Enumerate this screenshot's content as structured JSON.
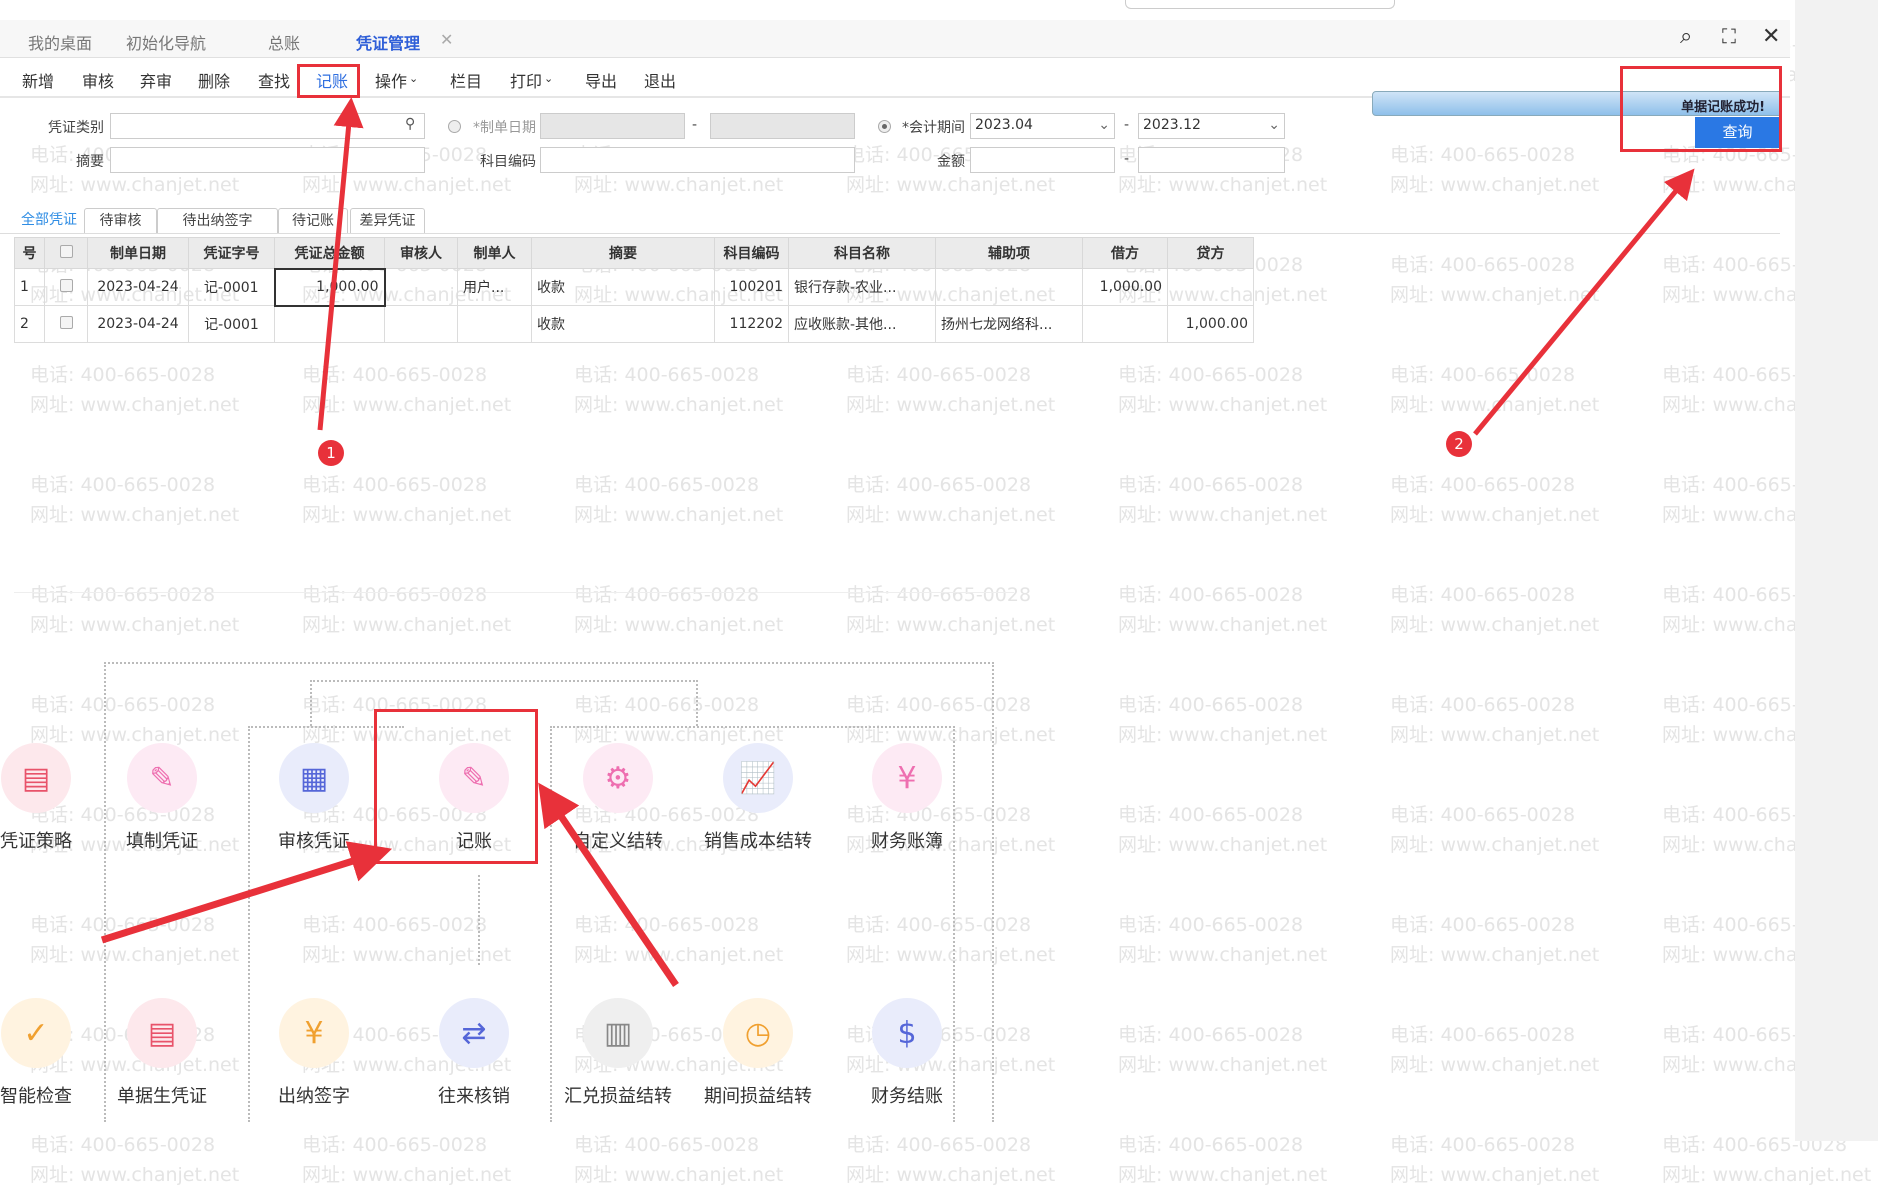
{
  "watermark": {
    "phone": "电话: 400-665-0028",
    "site": "网址: www.chanjet.net"
  },
  "tabs": [
    {
      "label": "我的桌面"
    },
    {
      "label": "初始化导航"
    },
    {
      "label": "总账"
    },
    {
      "label": "凭证管理",
      "active": true
    }
  ],
  "tab_close": "✕",
  "window_icons": {
    "search": "search-icon",
    "fullscreen": "expand-icon",
    "close": "close-icon"
  },
  "toolbar": [
    "新增",
    "审核",
    "弃审",
    "删除",
    "查找",
    "记账",
    "操作",
    "栏目",
    "打印",
    "导出",
    "退出"
  ],
  "filters": {
    "voucher_type_label": "凭证类别",
    "voucher_type_value": "",
    "summary_label": "摘要",
    "summary_value": "",
    "date_label": "*制单日期",
    "date_from": "",
    "date_to": "",
    "account_code_label": "科目编码",
    "account_code_value": "",
    "period_label": "*会计期间",
    "period_from": "2023.04",
    "period_to": "2023.12",
    "amount_label": "金额",
    "amount_from": "",
    "amount_to": "",
    "dash": "-"
  },
  "notice": {
    "message": "单据记账成功!",
    "query_button": "查询"
  },
  "filter_tabs": [
    "全部凭证",
    "待审核",
    "待出纳签字",
    "待记账",
    "差异凭证"
  ],
  "table": {
    "headers": [
      "号",
      "",
      "制单日期",
      "凭证字号",
      "凭证总金额",
      "审核人",
      "制单人",
      "摘要",
      "科目编码",
      "科目名称",
      "辅助项",
      "借方",
      "贷方"
    ],
    "rows": [
      [
        "1",
        "",
        "2023-04-24",
        "记-0001",
        "1,000.00",
        "",
        "用户...",
        "收款",
        "100201",
        "银行存款-农业...",
        "",
        "1,000.00",
        ""
      ],
      [
        "2",
        "",
        "2023-04-24",
        "记-0001",
        "",
        "",
        "",
        "收款",
        "112202",
        "应收账款-其他...",
        "扬州七龙网络科...",
        "",
        "1,000.00"
      ]
    ]
  },
  "annotations": [
    "1",
    "2"
  ],
  "flow": {
    "row1": [
      {
        "label": "凭证策略",
        "color": "#e8536a",
        "bg": "#fde8ec",
        "icon": "▤"
      },
      {
        "label": "填制凭证",
        "color": "#ee6fb0",
        "bg": "#fdeaf4",
        "icon": "✎"
      },
      {
        "label": "审核凭证",
        "color": "#5566d8",
        "bg": "#e9ecfb",
        "icon": "▦"
      },
      {
        "label": "记账",
        "color": "#ee6fb0",
        "bg": "#fdeaf4",
        "icon": "✎"
      },
      {
        "label": "自定义结转",
        "color": "#ee6fb0",
        "bg": "#fdeaf4",
        "icon": "⚙"
      },
      {
        "label": "销售成本结转",
        "color": "#5566d8",
        "bg": "#e9ecfb",
        "icon": "📈"
      },
      {
        "label": "财务账簿",
        "color": "#ee6fb0",
        "bg": "#fdeaf4",
        "icon": "¥"
      }
    ],
    "row2": [
      {
        "label": "智能检查",
        "color": "#f0a030",
        "bg": "#fff3e0",
        "icon": "✓"
      },
      {
        "label": "单据生凭证",
        "color": "#e8536a",
        "bg": "#fde8ec",
        "icon": "▤"
      },
      {
        "label": "出纳签字",
        "color": "#f0a030",
        "bg": "#fff3e0",
        "icon": "¥"
      },
      {
        "label": "往来核销",
        "color": "#5566d8",
        "bg": "#e9ecfb",
        "icon": "⇄"
      },
      {
        "label": "汇兑损益结转",
        "color": "#888",
        "bg": "#efefef",
        "icon": "▥"
      },
      {
        "label": "期间损益结转",
        "color": "#f0a030",
        "bg": "#fff3e0",
        "icon": "◷"
      },
      {
        "label": "财务结账",
        "color": "#5566d8",
        "bg": "#e9ecfb",
        "icon": "$"
      }
    ]
  }
}
